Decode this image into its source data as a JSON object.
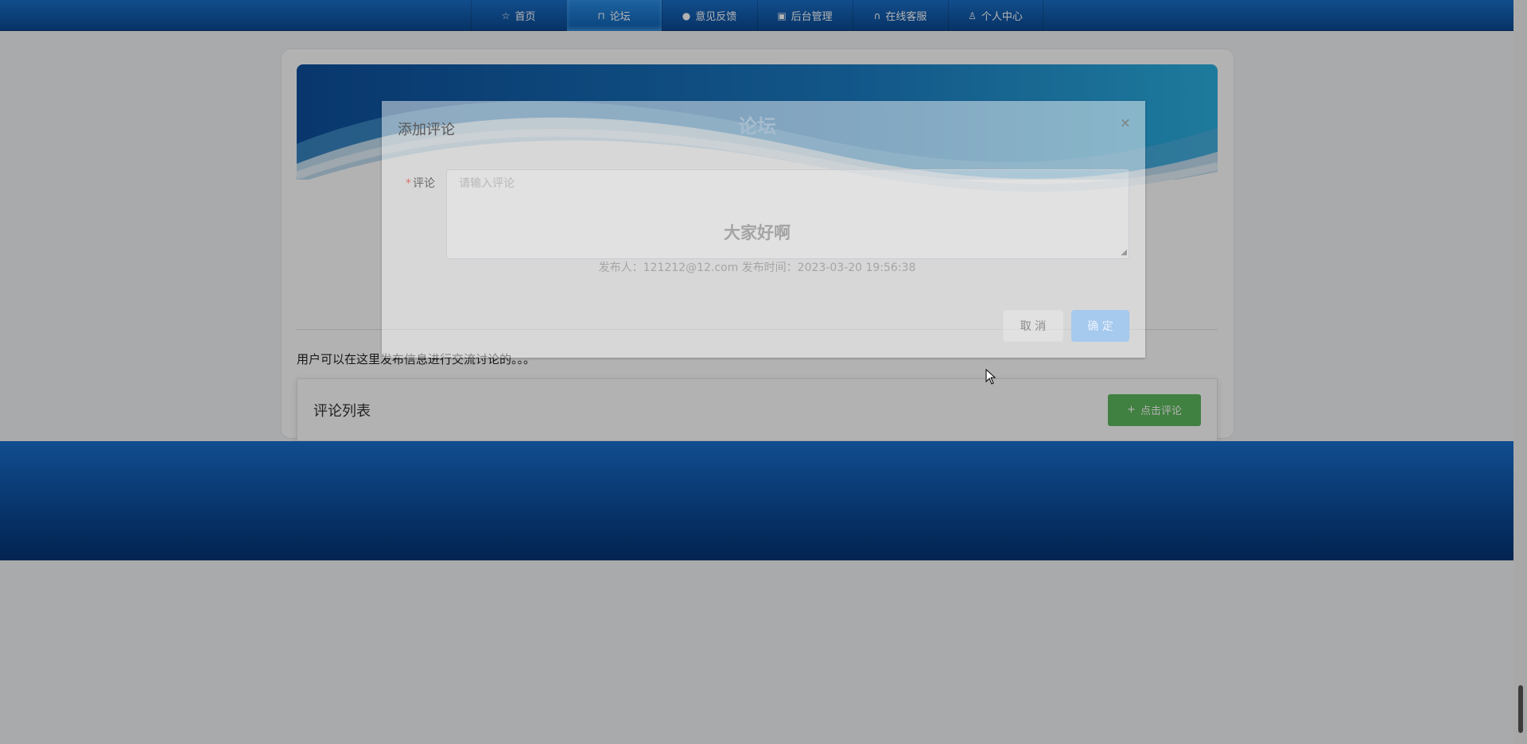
{
  "nav": {
    "items": [
      {
        "label": "首页",
        "icon": "star-icon",
        "glyph": "☆"
      },
      {
        "label": "论坛",
        "icon": "bag-icon",
        "glyph": "🛍"
      },
      {
        "label": "意见反馈",
        "icon": "exclamation-icon",
        "glyph": "❗"
      },
      {
        "label": "后台管理",
        "icon": "briefcase-icon",
        "glyph": "▣"
      },
      {
        "label": "在线客服",
        "icon": "headset-icon",
        "glyph": "🎧"
      },
      {
        "label": "个人中心",
        "icon": "user-icon",
        "glyph": "👤"
      }
    ],
    "active_index": 1
  },
  "banner": {
    "title": "论坛"
  },
  "post": {
    "title": "大家好啊",
    "meta": "发布人：121212@12.com  发布时间：2023-03-20 19:56:38",
    "content": "用户可以在这里发布信息进行交流讨论的。。。"
  },
  "comments": {
    "header": "评论列表",
    "add_button": "点击评论",
    "add_glyph": "+"
  },
  "dialog": {
    "title": "添加评论",
    "close_glyph": "×",
    "field_required_mark": "*",
    "field_label": "评论",
    "field_placeholder": "请输入评论",
    "cancel_label": "取 消",
    "ok_label": "确 定"
  },
  "colors": {
    "nav_blue": "#0b4a93",
    "banner_blue": "#2196d3",
    "accent_green": "#5cb85c",
    "primary_button": "#409eff"
  }
}
